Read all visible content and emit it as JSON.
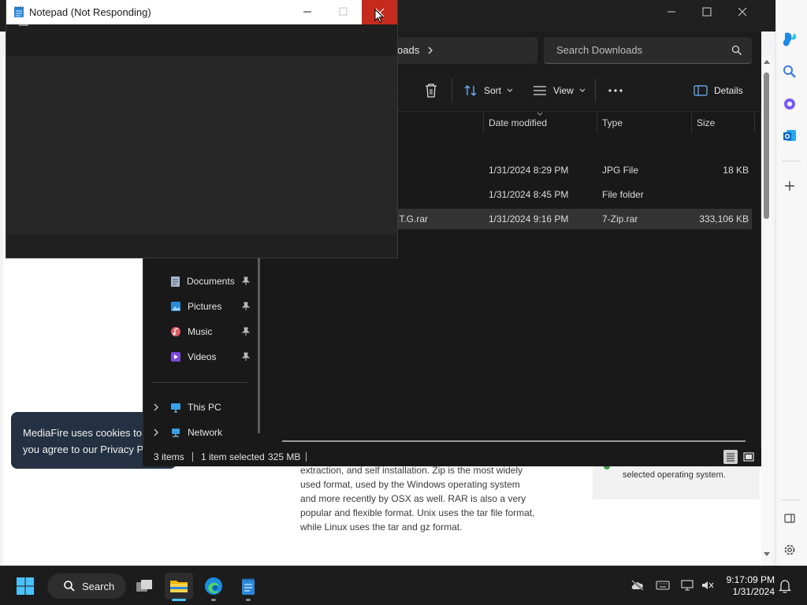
{
  "notepad": {
    "title": "Notepad (Not Responding)"
  },
  "explorer": {
    "address_segment": "oads",
    "search_placeholder": "Search Downloads",
    "toolbar": {
      "sort_label": "Sort",
      "view_label": "View",
      "details_label": "Details"
    },
    "columns": [
      "Date modified",
      "Type",
      "Size"
    ],
    "rows": [
      {
        "name": "",
        "date": "1/31/2024 8:29 PM",
        "type": "JPG File",
        "size": "18 KB",
        "selected": false
      },
      {
        "name": "",
        "date": "1/31/2024 8:45 PM",
        "type": "File folder",
        "size": "",
        "selected": false
      },
      {
        "name": ".T.G.rar",
        "date": "1/31/2024 9:16 PM",
        "type": "7-Zip.rar",
        "size": "333,106 KB",
        "selected": true
      }
    ],
    "nav": {
      "quick_access": [
        "Documents",
        "Pictures",
        "Music",
        "Videos"
      ],
      "locations": [
        "This PC",
        "Network"
      ]
    },
    "status": {
      "items": "3 items",
      "selected": "1 item selected",
      "size": "325 MB"
    }
  },
  "browser": {
    "cookie_lines": [
      "MediaFire uses cookies to",
      "you agree to our Privacy P"
    ],
    "article_lines": [
      "extraction, and self installation. Zip is the most widely",
      "used format, used by the Windows operating system",
      "and more recently by OSX as well. RAR is also a very",
      "popular and flexible format. Unix uses the tar file format,",
      "while Linux uses the tar and gz format."
    ],
    "info_text": "selected operating system."
  },
  "taskbar": {
    "search_label": "Search",
    "clock": {
      "time": "9:17:09 PM",
      "date": "1/31/2024"
    }
  },
  "colors": {
    "close_red": "#c42b1c",
    "explorer_bg": "#191919",
    "taskbar_bg": "#1c1c1c",
    "cookie_bg": "#243142"
  }
}
